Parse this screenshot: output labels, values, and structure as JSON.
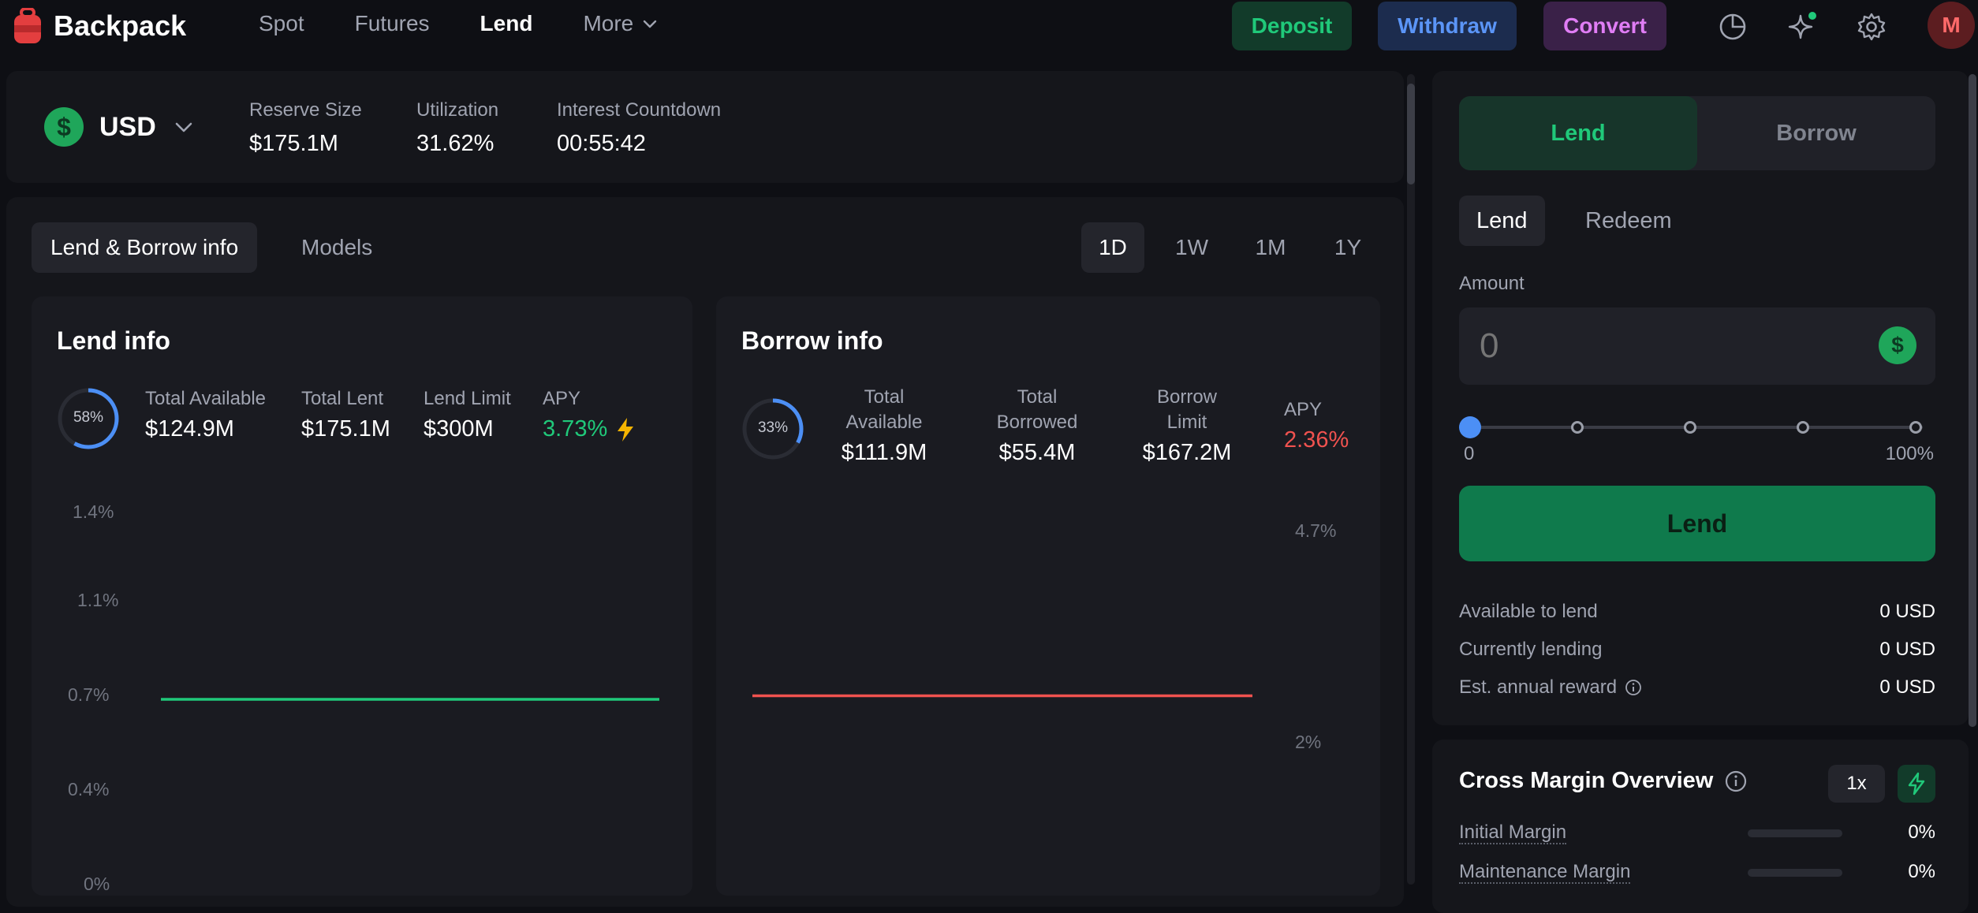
{
  "app": {
    "name": "Backpack"
  },
  "nav": {
    "items": [
      {
        "label": "Spot",
        "active": false
      },
      {
        "label": "Futures",
        "active": false
      },
      {
        "label": "Lend",
        "active": true
      },
      {
        "label": "More",
        "active": false
      }
    ]
  },
  "actions": {
    "deposit": "Deposit",
    "withdraw": "Withdraw",
    "convert": "Convert"
  },
  "header_icons": [
    "portfolio-pie-icon",
    "sparkle-ai-icon",
    "settings-gear-icon"
  ],
  "user": {
    "avatar_initial": "M"
  },
  "reserve": {
    "asset": "USD",
    "asset_icon": "$",
    "stats": [
      {
        "label": "Reserve Size",
        "value": "$175.1M"
      },
      {
        "label": "Utilization",
        "value": "31.62%"
      },
      {
        "label": "Interest Countdown",
        "value": "00:55:42"
      }
    ]
  },
  "info_tabs": [
    "Lend & Borrow info",
    "Models"
  ],
  "ranges": [
    "1D",
    "1W",
    "1M",
    "1Y"
  ],
  "active_range": "1D",
  "lend_info": {
    "title": "Lend info",
    "ring_label": "58%",
    "ring_value": 0.58,
    "stats": [
      {
        "label": "Total Available",
        "value": "$124.9M"
      },
      {
        "label": "Total Lent",
        "value": "$175.1M"
      },
      {
        "label": "Lend Limit",
        "value": "$300M"
      }
    ],
    "apy_label": "APY",
    "apy_value": "3.73%"
  },
  "borrow_info": {
    "title": "Borrow info",
    "ring_label": "33%",
    "ring_value": 0.33,
    "stats": [
      {
        "label": "Total Available",
        "value": "$111.9M"
      },
      {
        "label": "Total Borrowed",
        "value": "$55.4M"
      },
      {
        "label": "Borrow Limit",
        "value": "$167.2M"
      }
    ],
    "apy_label": "APY",
    "apy_value": "2.36%"
  },
  "colors": {
    "lend_line": "#20c97a",
    "borrow_line": "#f0524f",
    "accent_blue": "#4c8ff5"
  },
  "chart_data": [
    {
      "type": "line",
      "y_ticks": [
        "1.4%",
        "1.1%",
        "0.7%",
        "0.4%",
        "0%"
      ],
      "ylim": [
        0,
        1.4
      ],
      "series": [
        {
          "values": [
            0.7,
            0.7,
            0.7,
            0.7,
            0.7,
            0.7,
            0.7,
            0.7,
            0.7,
            0.7,
            0.7,
            0.7,
            0.7,
            0.7,
            0.7,
            0.7,
            0.7,
            0.7,
            0.7,
            0.7,
            0.7,
            0.7,
            0.7,
            0.7
          ]
        }
      ]
    },
    {
      "type": "line",
      "y_ticks": [
        "4.7%",
        "2%"
      ],
      "series": [
        {
          "values": [
            2.36,
            2.36,
            2.36,
            2.36,
            2.36,
            2.36,
            2.36,
            2.36,
            2.36,
            2.36,
            2.36,
            2.36,
            2.36,
            2.36,
            2.36,
            2.36,
            2.36,
            2.36,
            2.36,
            2.36,
            2.36,
            2.36,
            2.36,
            2.36,
            2.36,
            2.36,
            2.36,
            2.36,
            2.36,
            2.36,
            2.36,
            2.36,
            2.36,
            2.36,
            2.36,
            2.36,
            2.36,
            2.36,
            2.36,
            2.36,
            2.36,
            2.36,
            2.36,
            2.36,
            2.36,
            2.36,
            2.36,
            2.36,
            2.36,
            2.36,
            2.36,
            2.36,
            2.36,
            2.36,
            2.36,
            2.36,
            2.36,
            2.36,
            2.36,
            2.36,
            2.36,
            2.36,
            2.36,
            2.36,
            2.36,
            2.36,
            2.36,
            2.36,
            2.36,
            2.36,
            2.36,
            2.36,
            2.36,
            2.36,
            2.36,
            2.36,
            2.36,
            2.36,
            2.36,
            2.36,
            2.36,
            2.36,
            2.36,
            2.36,
            2.36,
            2.36,
            2.36,
            2.36,
            2.36,
            2.36,
            2.36,
            2.36,
            2.36,
            2.36,
            2.36,
            2.36
          ]
        }
      ]
    }
  ],
  "trade": {
    "mode_tabs": [
      "Lend",
      "Borrow"
    ],
    "active_mode": "Lend",
    "sub_tabs": [
      "Lend",
      "Redeem"
    ],
    "amount_label": "Amount",
    "amount_placeholder": "0",
    "slider_value": 0,
    "slider_min": "0",
    "slider_max": "100%",
    "submit": "Lend",
    "summary": [
      {
        "label": "Available to lend",
        "value": "0 USD",
        "info": false
      },
      {
        "label": "Currently lending",
        "value": "0 USD",
        "info": false
      },
      {
        "label": "Est. annual reward",
        "value": "0 USD",
        "info": true
      }
    ]
  },
  "margin": {
    "title": "Cross Margin Overview",
    "leverage": "1x",
    "rows": [
      {
        "label": "Initial Margin",
        "value": "0%"
      },
      {
        "label": "Maintenance Margin",
        "value": "0%"
      }
    ]
  }
}
